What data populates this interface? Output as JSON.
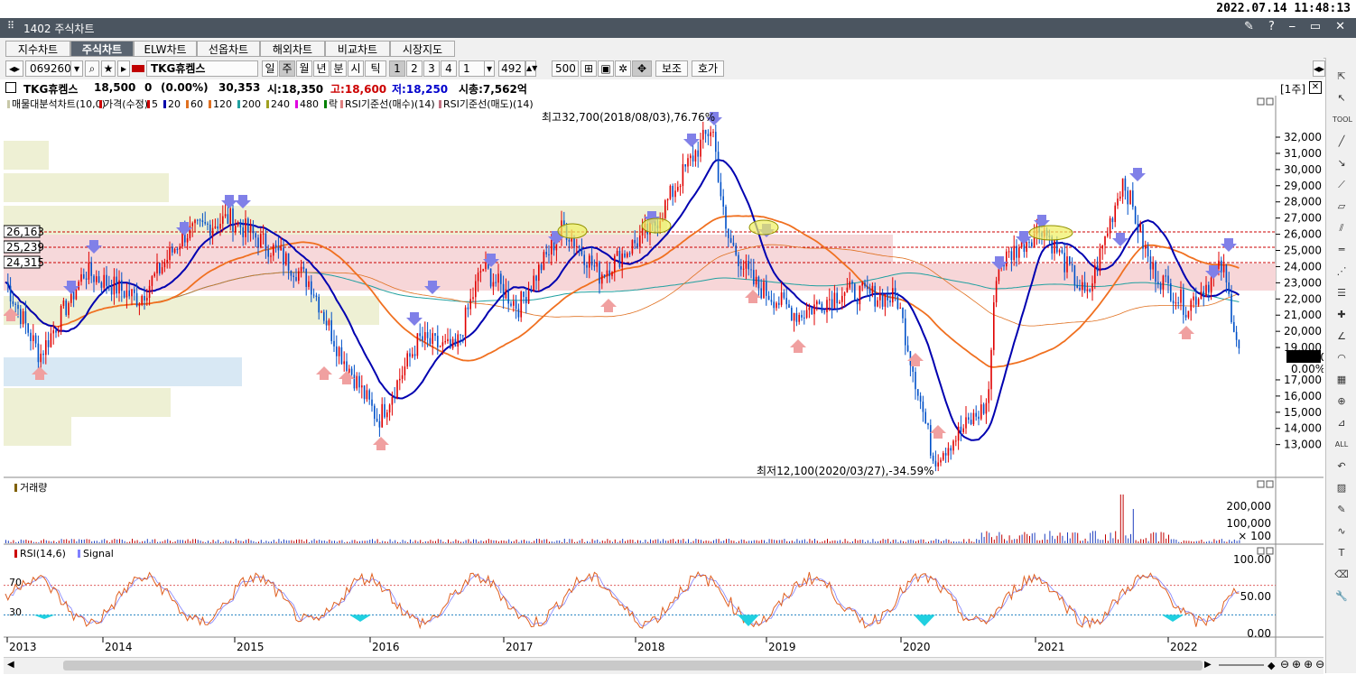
{
  "clock": "2022.07.14 11:48:13",
  "window": {
    "title": "1402 주식차트"
  },
  "tabs": [
    "지수차트",
    "주식차트",
    "ELW차트",
    "선옵차트",
    "해외차트",
    "비교차트",
    "시장지도"
  ],
  "toolbar": {
    "code": "069260",
    "name": "TKG휴켐스",
    "periods": [
      "일",
      "주",
      "월",
      "년",
      "분",
      "시",
      "틱"
    ],
    "nums": [
      "1",
      "2",
      "3",
      "4"
    ],
    "interval": "1",
    "count": "492",
    "total": "500",
    "btn_aux": "보조",
    "btn_quote": "호가"
  },
  "info": {
    "name": "TKG휴켐스",
    "price": "18,500",
    "change": "0",
    "pct": "(0.00%)",
    "volume": "30,353",
    "open": "시:18,350",
    "high": "고:18,600",
    "low": "저:18,250",
    "cap": "시총:7,562억",
    "period_tag": "[1주]"
  },
  "legend_main": [
    {
      "text": "매물대분석차트(10,0)",
      "color": "#c8c8a8"
    },
    {
      "text": "가격(수정)",
      "color": "#cc0000"
    },
    {
      "text": "5",
      "color": "#cc0000"
    },
    {
      "text": "20",
      "color": "#0000aa"
    },
    {
      "text": "60",
      "color": "#e07020"
    },
    {
      "text": "120",
      "color": "#e07020"
    },
    {
      "text": "200",
      "color": "#20a0a0"
    },
    {
      "text": "240",
      "color": "#a0a020"
    },
    {
      "text": "480",
      "color": "#e000e0"
    },
    {
      "text": "락",
      "color": "#008000"
    },
    {
      "text": "RSI기준선(매수)(14)",
      "color": "#e08080"
    },
    {
      "text": "RSI기준선(매도)(14)",
      "color": "#c07080"
    }
  ],
  "annotations": {
    "high": "최고32,700(2018/08/03),76.76%",
    "low": "최저12,100(2020/03/27),-34.59%"
  },
  "ref_lines": [
    "26,163",
    "25,239",
    "24,315"
  ],
  "price_axis": [
    "32,000",
    "31,000",
    "30,000",
    "29,000",
    "28,000",
    "27,000",
    "26,000",
    "25,000",
    "24,000",
    "23,000",
    "22,000",
    "21,000",
    "20,000",
    "19,000",
    "17,000",
    "16,000",
    "15,000",
    "14,000",
    "13,000"
  ],
  "current_price": "18,500",
  "current_pct": "0.00%",
  "volume_panel": {
    "label": "거래량",
    "axis": [
      "200,000",
      "100,000",
      "× 100"
    ]
  },
  "rsi_panel": {
    "label": "RSI(14,6)",
    "signal": "Signal",
    "axis": [
      "100.00",
      "50.00",
      "0.00"
    ],
    "levels": [
      "70",
      "30"
    ]
  },
  "x_axis": [
    "2013",
    "2014",
    "2015",
    "2016",
    "2017",
    "2018",
    "2019",
    "2020",
    "2021",
    "2022"
  ],
  "colors": {
    "up": "#e00000",
    "down": "#0050c8",
    "ma20": "#0000b0",
    "ma60": "#f07020"
  }
}
